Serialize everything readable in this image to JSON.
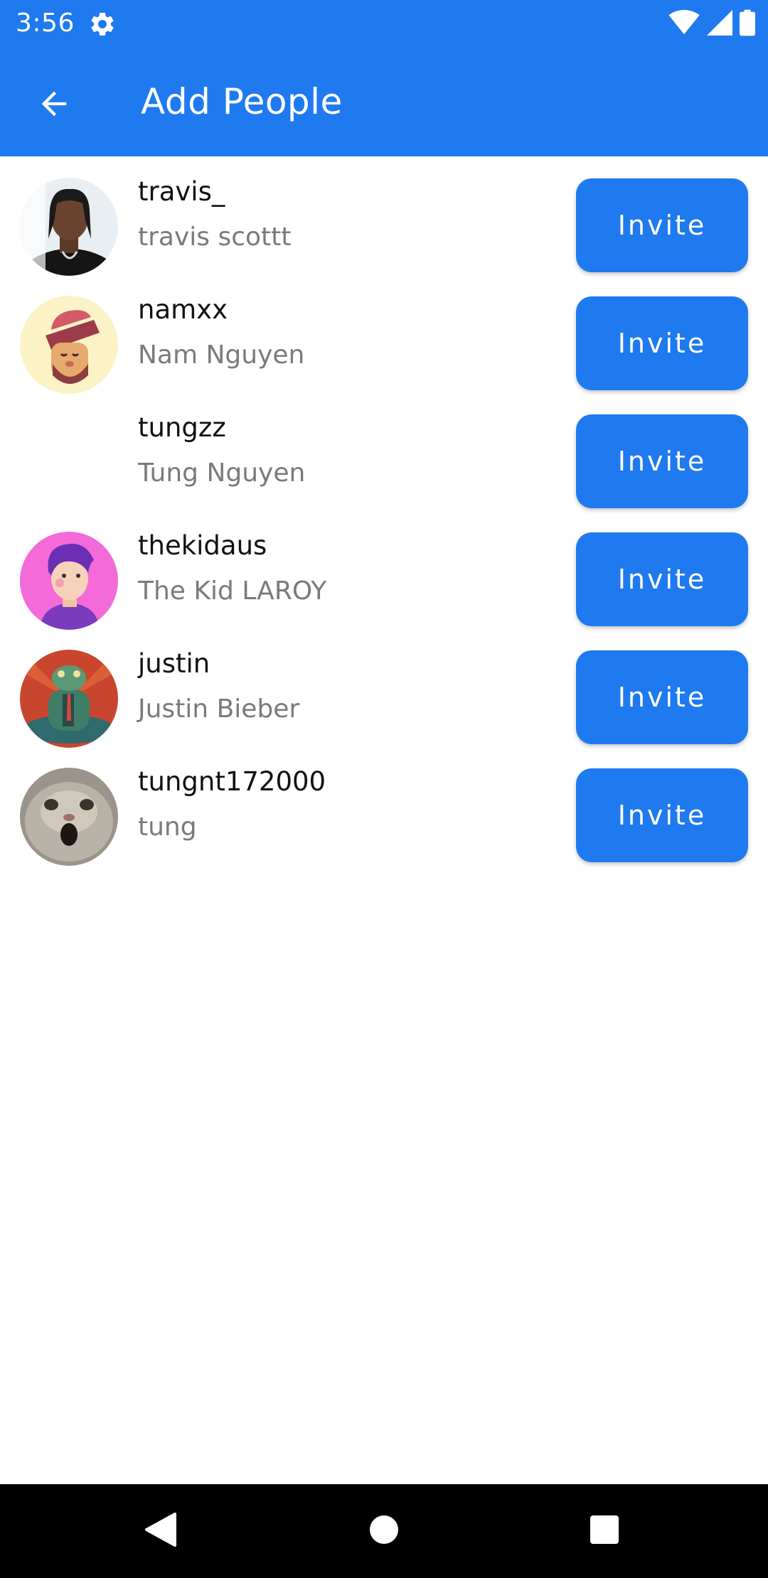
{
  "status_bar": {
    "time": "3:56",
    "icons": [
      "gear-icon",
      "wifi-icon",
      "signal-icon",
      "battery-icon"
    ]
  },
  "app_bar": {
    "title": "Add People",
    "back_icon": "arrow-left-icon"
  },
  "colors": {
    "primary": "#1f7aef",
    "username": "#111111",
    "fullname": "#7a7a7a",
    "nav_bar": "#000000"
  },
  "people": [
    {
      "username": "travis_",
      "fullname": "travis scottt",
      "button": "Invite",
      "avatar": "photo-portrait"
    },
    {
      "username": "namxx",
      "fullname": "Nam Nguyen",
      "button": "Invite",
      "avatar": "cartoon-man-cap"
    },
    {
      "username": "tungzz",
      "fullname": "Tung Nguyen",
      "button": "Invite",
      "avatar": "none"
    },
    {
      "username": "thekidaus",
      "fullname": "The Kid LAROY",
      "button": "Invite",
      "avatar": "cartoon-boy-purple"
    },
    {
      "username": "justin",
      "fullname": "Justin Bieber",
      "button": "Invite",
      "avatar": "illustration-frog"
    },
    {
      "username": "tungnt172000",
      "fullname": "tung",
      "button": "Invite",
      "avatar": "photo-cat"
    }
  ],
  "nav_bar": {
    "icons": [
      "back-triangle-icon",
      "home-circle-icon",
      "recents-square-icon"
    ]
  }
}
